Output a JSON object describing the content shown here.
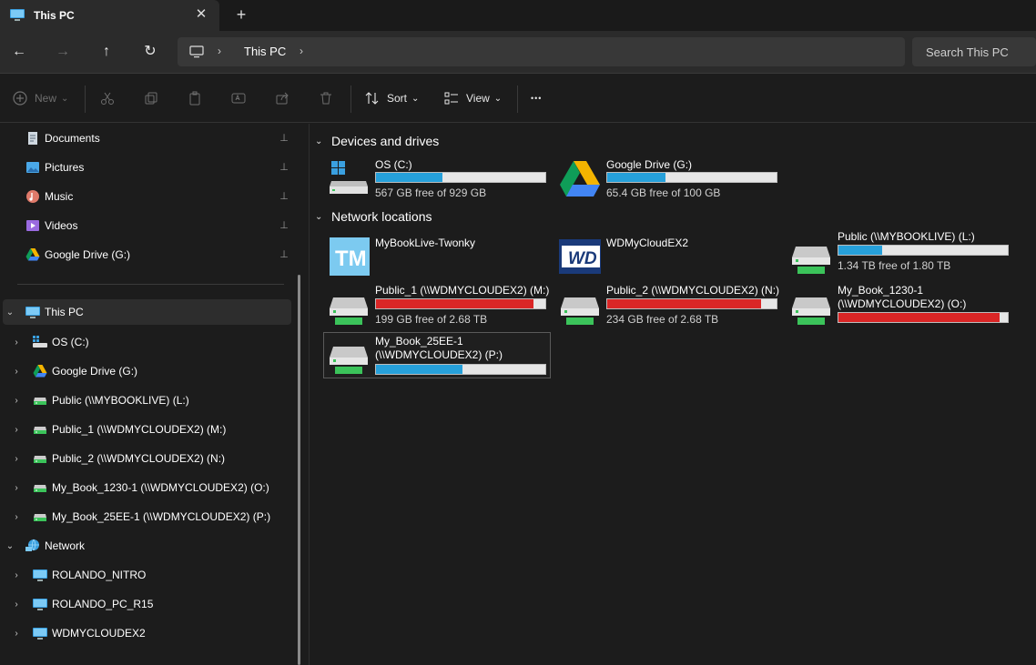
{
  "window": {
    "tab_title": "This PC",
    "close_glyph": "✕",
    "newtab_glyph": "+"
  },
  "nav": {
    "back_glyph": "←",
    "forward_glyph": "→",
    "up_glyph": "↑",
    "refresh_glyph": "↻",
    "breadcrumb": "This PC",
    "chevron": "›",
    "search_placeholder": "Search This PC"
  },
  "toolbar": {
    "new_label": "New",
    "sort_label": "Sort",
    "view_label": "View",
    "more_glyph": "•••",
    "dropdown_glyph": "⌄"
  },
  "sidebar": {
    "quick_access": [
      {
        "label": "Documents",
        "icon": "documents-icon"
      },
      {
        "label": "Pictures",
        "icon": "pictures-icon"
      },
      {
        "label": "Music",
        "icon": "music-icon"
      },
      {
        "label": "Videos",
        "icon": "videos-icon"
      },
      {
        "label": "Google Drive (G:)",
        "icon": "google-drive-icon"
      }
    ],
    "this_pc_label": "This PC",
    "drives": [
      {
        "label": "OS (C:)",
        "icon": "windows-drive-icon"
      },
      {
        "label": "Google Drive (G:)",
        "icon": "google-drive-icon"
      },
      {
        "label": "Public (\\\\MYBOOKLIVE) (L:)",
        "icon": "network-drive-icon"
      },
      {
        "label": "Public_1 (\\\\WDMYCLOUDEX2) (M:)",
        "icon": "network-drive-icon"
      },
      {
        "label": "Public_2 (\\\\WDMYCLOUDEX2) (N:)",
        "icon": "network-drive-icon"
      },
      {
        "label": "My_Book_1230-1 (\\\\WDMYCLOUDEX2) (O:)",
        "icon": "network-drive-icon"
      },
      {
        "label": "My_Book_25EE-1 (\\\\WDMYCLOUDEX2) (P:)",
        "icon": "network-drive-icon"
      }
    ],
    "network_label": "Network",
    "network_items": [
      {
        "label": "ROLANDO_NITRO",
        "icon": "computer-icon"
      },
      {
        "label": "ROLANDO_PC_R15",
        "icon": "computer-icon"
      },
      {
        "label": "WDMYCLOUDEX2",
        "icon": "computer-icon"
      }
    ],
    "pin_glyph": "📌",
    "expand_glyph": "›",
    "collapse_glyph": "⌄"
  },
  "main": {
    "devices_header": "Devices and drives",
    "network_header": "Network locations",
    "devices": [
      {
        "name": "OS (C:)",
        "free": "567 GB free of 929 GB",
        "used_fraction": 0.39,
        "bar_color": "blue",
        "icon": "windows-drive-icon"
      },
      {
        "name": "Google Drive (G:)",
        "free": "65.4 GB free of 100 GB",
        "used_fraction": 0.346,
        "bar_color": "blue",
        "icon": "google-drive-icon"
      }
    ],
    "network": [
      {
        "name": "MyBookLive-Twonky",
        "icon": "twonky-icon"
      },
      {
        "name": "WDMyCloudEX2",
        "icon": "wd-icon"
      },
      {
        "name": "Public (\\\\MYBOOKLIVE) (L:)",
        "free": "1.34 TB free of 1.80 TB",
        "used_fraction": 0.26,
        "bar_color": "blue",
        "icon": "network-drive-icon"
      },
      {
        "name": "Public_1 (\\\\WDMYCLOUDEX2) (M:)",
        "free": "199 GB free of 2.68 TB",
        "used_fraction": 0.93,
        "bar_color": "red",
        "icon": "network-drive-icon"
      },
      {
        "name": "Public_2 (\\\\WDMYCLOUDEX2) (N:)",
        "free": "234 GB free of 2.68 TB",
        "used_fraction": 0.91,
        "bar_color": "red",
        "icon": "network-drive-icon"
      },
      {
        "name": "My_Book_1230-1",
        "name2": "(\\\\WDMYCLOUDEX2) (O:)",
        "used_fraction": 0.95,
        "bar_color": "red",
        "icon": "network-drive-icon"
      },
      {
        "name": "My_Book_25EE-1",
        "name2": "(\\\\WDMYCLOUDEX2) (P:)",
        "used_fraction": 0.51,
        "bar_color": "blue",
        "icon": "network-drive-icon"
      }
    ]
  },
  "colors": {
    "accent_blue": "#26a0da",
    "warning_red": "#da2626",
    "background": "#1c1c1c"
  }
}
